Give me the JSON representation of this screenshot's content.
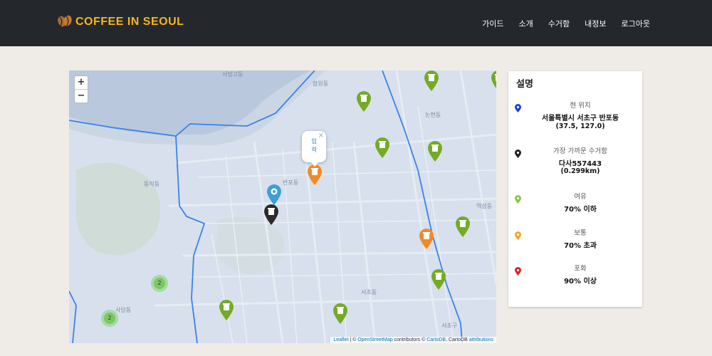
{
  "navbar": {
    "brand": "COFFEE IN SEOUL",
    "items": [
      "가이드",
      "소개",
      "수거함",
      "내정보",
      "로그아웃"
    ]
  },
  "map": {
    "zoom_in": "+",
    "zoom_out": "−",
    "popup": {
      "text": "입력",
      "close": "×"
    },
    "clusters": [
      {
        "count": "2"
      },
      {
        "count": "2"
      }
    ],
    "place_labels": [
      "서빙고동",
      "잠원동",
      "반포동",
      "동작동",
      "사당동",
      "서초동",
      "논현동",
      "역삼동",
      "서초구"
    ],
    "attribution": {
      "leaflet": "Leaflet",
      "sep1": " | © ",
      "osm": "OpenStreetMap",
      "contrib": " contributors © ",
      "carto": "CartoDB",
      "sep2": ", CartoDB ",
      "attr": "attributions"
    }
  },
  "legend": {
    "title": "설명",
    "current": {
      "label": "현 위치",
      "address": "서울특별시 서초구 반포동",
      "coords": "(37.5, 127.0)",
      "color": "#1a3fe0"
    },
    "nearest": {
      "label": "가장 가까운 수거함",
      "id": "다사557443",
      "distance": "(0.299km)",
      "color": "#222222"
    },
    "levels": [
      {
        "label": "여유",
        "value": "70% 이하",
        "color": "#8cc63f"
      },
      {
        "label": "보통",
        "value": "70% 초과",
        "color": "#f5a623"
      },
      {
        "label": "포화",
        "value": "90% 이상",
        "color": "#e02020"
      }
    ]
  },
  "colors": {
    "green": "#73ab24",
    "orange": "#f08a2a",
    "black": "#2b2b2b",
    "blue": "#3d9fd6",
    "navbar": "#24272b",
    "brand": "#f5b61a"
  },
  "icons": {
    "brand": "coffee-bean-icon",
    "marker": "trash-bin-icon",
    "current": "coffee-icon"
  }
}
